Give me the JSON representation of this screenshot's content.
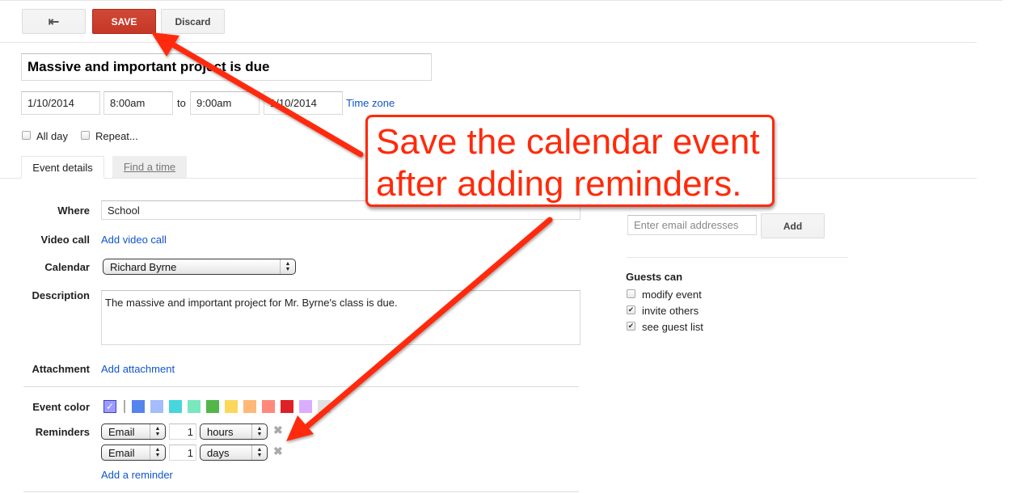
{
  "toolbar": {
    "back_icon": "back-arrow-icon",
    "save_label": "SAVE",
    "discard_label": "Discard"
  },
  "event": {
    "title": "Massive and important project is due",
    "start_date": "1/10/2014",
    "start_time": "8:00am",
    "to_label": "to",
    "end_time": "9:00am",
    "end_date": "1/10/2014",
    "timezone_link": "Time zone",
    "all_day_label": "All day",
    "all_day_checked": false,
    "repeat_label": "Repeat...",
    "repeat_checked": false
  },
  "tabs": [
    {
      "label": "Event details",
      "active": true
    },
    {
      "label": "Find a time",
      "active": false
    }
  ],
  "details": {
    "where_label": "Where",
    "where_value": "School",
    "video_label": "Video call",
    "video_link": "Add video call",
    "calendar_label": "Calendar",
    "calendar_value": "Richard Byrne",
    "description_label": "Description",
    "description_value": "The massive and important project for Mr. Byrne's class is due.",
    "attachment_label": "Attachment",
    "attachment_link": "Add attachment",
    "color_label": "Event color",
    "colors": [
      "#5484ed",
      "#a4bdfc",
      "#46d6db",
      "#7ae7bf",
      "#51b749",
      "#fbd75b",
      "#ffb878",
      "#ff887c",
      "#dc2127",
      "#dbadff",
      "#e1e1e1"
    ],
    "default_color": "#9a9cff",
    "reminders_label": "Reminders",
    "reminders": [
      {
        "method": "Email",
        "amount": "1",
        "unit": "hours"
      },
      {
        "method": "Email",
        "amount": "1",
        "unit": "days"
      }
    ],
    "add_reminder_link": "Add a reminder"
  },
  "guests": {
    "email_placeholder": "Enter email addresses",
    "add_label": "Add",
    "guests_can_label": "Guests can",
    "permissions": [
      {
        "label": "modify event",
        "checked": false
      },
      {
        "label": "invite others",
        "checked": true
      },
      {
        "label": "see guest list",
        "checked": true
      }
    ]
  },
  "annotation": {
    "callout_text_line1": "Save the calendar event",
    "callout_text_line2": "after adding reminders.",
    "color": "#ff2a0a"
  }
}
